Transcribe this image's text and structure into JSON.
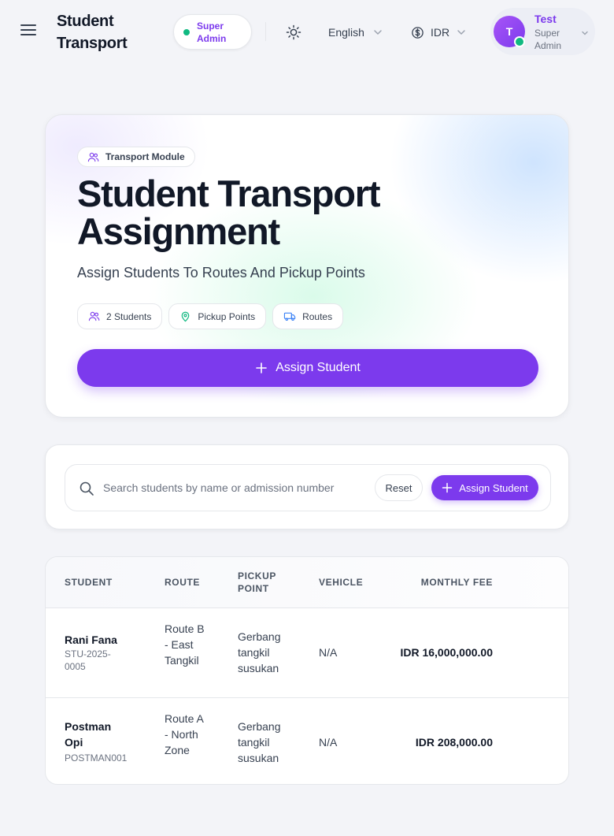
{
  "header": {
    "brand": "Student Transport",
    "role_badge": "Super Admin",
    "language": "English",
    "currency": "IDR",
    "user": {
      "initial": "T",
      "name": "Test",
      "role": "Super Admin"
    }
  },
  "hero": {
    "module_tag": "Transport Module",
    "title": "Student Transport Assignment",
    "subtitle": "Assign Students To Routes And Pickup Points",
    "chips": [
      "2 Students",
      "Pickup Points",
      "Routes"
    ],
    "cta_label": "Assign Student"
  },
  "search": {
    "placeholder": "Search students by name or admission number",
    "reset_label": "Reset",
    "assign_label": "Assign Student"
  },
  "table": {
    "columns": [
      "STUDENT",
      "ROUTE",
      "PICKUP POINT",
      "VEHICLE",
      "MONTHLY FEE"
    ],
    "rows": [
      {
        "name": "Rani Fana",
        "admission": "STU-2025-0005",
        "route": "Route B - East Tangkil",
        "pickup": "Gerbang tangkil susukan",
        "vehicle": "N/A",
        "fee": "IDR 16,000,000.00"
      },
      {
        "name": "Postman Opi",
        "admission": "POSTMAN001",
        "route": "Route A - North Zone",
        "pickup": "Gerbang tangkil susukan",
        "vehicle": "N/A",
        "fee": "IDR 208,000.00"
      }
    ]
  },
  "colors": {
    "accent": "#7c3aed",
    "online": "#10b981"
  },
  "icons": {
    "menu": "hamburger-menu-icon",
    "theme": "sun-icon",
    "currency": "dollar-circle-icon",
    "module": "users-icon",
    "pickup": "map-pin-icon",
    "routes": "bus-icon",
    "search": "search-icon",
    "plus": "plus-icon"
  }
}
